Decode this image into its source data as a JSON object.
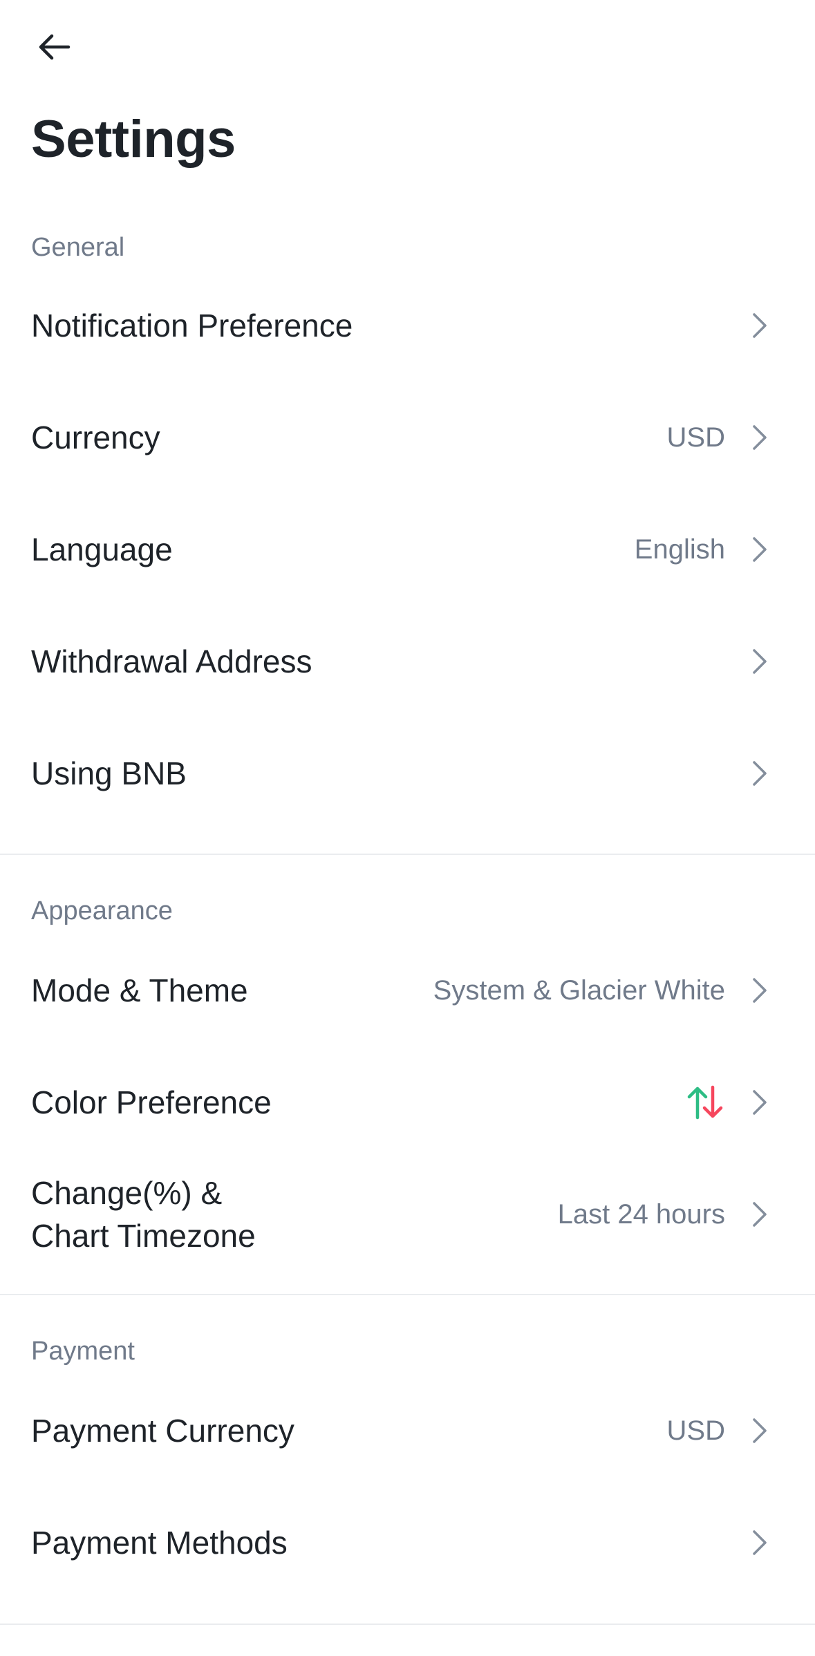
{
  "header": {
    "back_icon": "arrow-left-icon",
    "title": "Settings"
  },
  "sections": {
    "general": {
      "header": "General",
      "items": {
        "notification": {
          "label": "Notification Preference",
          "value": ""
        },
        "currency": {
          "label": "Currency",
          "value": "USD"
        },
        "language": {
          "label": "Language",
          "value": "English"
        },
        "withdrawal": {
          "label": "Withdrawal Address",
          "value": ""
        },
        "bnb": {
          "label": "Using BNB",
          "value": ""
        }
      }
    },
    "appearance": {
      "header": "Appearance",
      "items": {
        "mode": {
          "label": "Mode & Theme",
          "value": "System & Glacier White"
        },
        "color": {
          "label": "Color Preference",
          "icon": "up-down-arrows-icon",
          "up_color": "#2ebd85",
          "down_color": "#f6465d"
        },
        "change_line1": "Change(%) &",
        "change_line2": "Chart Timezone",
        "change_value": "Last 24 hours"
      }
    },
    "payment": {
      "header": "Payment",
      "items": {
        "payment_currency": {
          "label": "Payment Currency",
          "value": "USD"
        },
        "payment_methods": {
          "label": "Payment Methods",
          "value": ""
        }
      }
    }
  },
  "colors": {
    "text_primary": "#1e2329",
    "text_secondary": "#707a8a",
    "divider": "#eaecef",
    "chevron": "#848e9c"
  }
}
